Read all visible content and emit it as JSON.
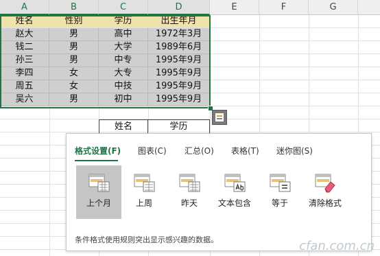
{
  "columns": [
    "A",
    "B",
    "C",
    "D",
    "E",
    "F",
    "G"
  ],
  "table": {
    "headers": [
      "姓名",
      "性别",
      "学历",
      "出生年月"
    ],
    "rows": [
      [
        "赵大",
        "男",
        "高中",
        "1972年3月"
      ],
      [
        "钱二",
        "男",
        "大学",
        "1989年6月"
      ],
      [
        "孙三",
        "男",
        "中专",
        "1995年9月"
      ],
      [
        "李四",
        "女",
        "大专",
        "1995年9月"
      ],
      [
        "周五",
        "女",
        "中技",
        "1995年9月"
      ],
      [
        "吴六",
        "男",
        "初中",
        "1995年9月"
      ]
    ]
  },
  "lower_headers": [
    "姓名",
    "学历"
  ],
  "quick_analysis": {
    "tabs": [
      {
        "label": "格式设置(F)",
        "active": true
      },
      {
        "label": "图表(C)",
        "active": false
      },
      {
        "label": "汇总(O)",
        "active": false
      },
      {
        "label": "表格(T)",
        "active": false
      },
      {
        "label": "迷你图(S)",
        "active": false
      }
    ],
    "options": [
      {
        "label": "上个月",
        "icon": "calendar-icon",
        "selected": true
      },
      {
        "label": "上周",
        "icon": "highlight-icon",
        "selected": false
      },
      {
        "label": "昨天",
        "icon": "calendar-icon",
        "selected": false
      },
      {
        "label": "文本包含",
        "icon": "text-contains-icon",
        "selected": false
      },
      {
        "label": "等于",
        "icon": "equal-to-icon",
        "selected": false
      },
      {
        "label": "清除格式",
        "icon": "eraser-icon",
        "selected": false
      }
    ],
    "description": "条件格式使用规则突出显示感兴趣的数据。"
  },
  "watermark": "cfan.com.cn",
  "colors": {
    "accent": "#217346",
    "header_fill": "#f0e2ab",
    "data_fill": "#cfcfcf",
    "selected_option": "#c6c6c6"
  }
}
